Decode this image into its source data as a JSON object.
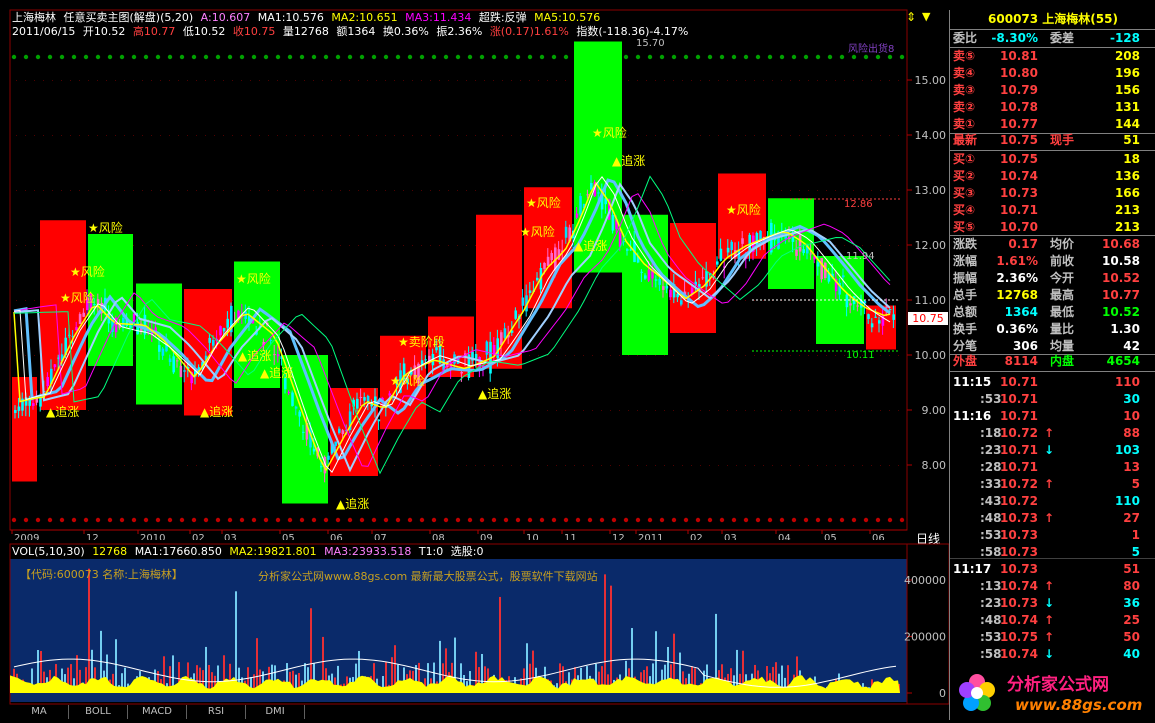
{
  "title_bar": {
    "stock_name": "上海梅林",
    "indicator": "任意买卖主图(解盘)(5,20)",
    "a_label": "A:10.607",
    "ma1": "MA1:10.576",
    "ma2": "MA2:10.651",
    "ma3": "MA3:11.434",
    "super": "超跌:反弹",
    "ma5": "MA5:10.576"
  },
  "info_line": {
    "date": "2011/06/15",
    "open": "开10.52",
    "high": "高10.77",
    "low": "低10.52",
    "close": "收10.75",
    "volume": "量12768",
    "amount": "额1364",
    "turnover": "换0.36%",
    "amplitude": "振2.36%",
    "change": "涨(0.17)1.61%",
    "index": "指数(-118.36)-4.17%"
  },
  "main_chart": {
    "y_ticks": [
      "15.00",
      "14.00",
      "13.00",
      "12.00",
      "11.00",
      "10.00",
      "9.00",
      "8.00"
    ],
    "x_ticks": [
      "2009",
      "12",
      "2010",
      "02",
      "03",
      "05",
      "06",
      "07",
      "08",
      "09",
      "10",
      "11",
      "12",
      "2011",
      "02",
      "03",
      "04",
      "05",
      "06"
    ],
    "period_button": "日线",
    "current_price_tag": "10.75",
    "annotations": {
      "high_label": "15.70",
      "level_1": "12.86",
      "level_2": "11.94",
      "level_3": "10.11",
      "risk": "★风险",
      "chase": "▲追涨",
      "first_sell": "★卖阶段",
      "top_right_ghost": "风险出货8"
    }
  },
  "vol_header": {
    "title": "VOL(5,10,30)",
    "value": "12768",
    "ma1": "MA1:17660.850",
    "ma2": "MA2:19821.801",
    "ma3": "MA3:23933.518",
    "t1": "T1:0",
    "select": "选股:0"
  },
  "vol_chart": {
    "y_ticks": [
      "400000",
      "200000",
      "0"
    ],
    "watermark_code": "【代码:600073 名称:上海梅林】",
    "watermark_site": "分析家公式网www.88gs.com 最新最大股票公式，股票软件下载网站"
  },
  "tabs": [
    "MA",
    "BOLL",
    "MACD",
    "RSI",
    "DMI"
  ],
  "quote_panel": {
    "title": "600073 上海梅林(55)",
    "weibi_label": "委比",
    "weibi_value": "-8.30%",
    "weicha_label": "委差",
    "weicha_value": "-128",
    "asks": [
      {
        "label": "卖⑤",
        "price": "10.81",
        "vol": "208"
      },
      {
        "label": "卖④",
        "price": "10.80",
        "vol": "196"
      },
      {
        "label": "卖③",
        "price": "10.79",
        "vol": "156"
      },
      {
        "label": "卖②",
        "price": "10.78",
        "vol": "131"
      },
      {
        "label": "卖①",
        "price": "10.77",
        "vol": "144"
      }
    ],
    "latest_label": "最新",
    "latest_value": "10.75",
    "xianshou_label": "现手",
    "xianshou_value": "51",
    "bids": [
      {
        "label": "买①",
        "price": "10.75",
        "vol": "18"
      },
      {
        "label": "买②",
        "price": "10.74",
        "vol": "136"
      },
      {
        "label": "买③",
        "price": "10.73",
        "vol": "166"
      },
      {
        "label": "买④",
        "price": "10.71",
        "vol": "213"
      },
      {
        "label": "买⑤",
        "price": "10.70",
        "vol": "213"
      }
    ],
    "stats": [
      {
        "l1": "涨跌",
        "v1": "0.17",
        "l2": "均价",
        "v2": "10.68"
      },
      {
        "l1": "涨幅",
        "v1": "1.61%",
        "l2": "前收",
        "v2": "10.58"
      },
      {
        "l1": "振幅",
        "v1": "2.36%",
        "l2": "今开",
        "v2": "10.52"
      },
      {
        "l1": "总手",
        "v1": "12768",
        "l2": "最高",
        "v2": "10.77"
      },
      {
        "l1": "总额",
        "v1": "1364",
        "l2": "最低",
        "v2": "10.52"
      },
      {
        "l1": "换手",
        "v1": "0.36%",
        "l2": "量比",
        "v2": "1.30"
      },
      {
        "l1": "分笔",
        "v1": "306",
        "l2": "均量",
        "v2": "42"
      }
    ],
    "outer_label": "外盘",
    "outer_value": "8114",
    "inner_label": "内盘",
    "inner_value": "4654",
    "ticks": [
      {
        "t": "11:15",
        "p": "10.71",
        "a": "",
        "v": "110"
      },
      {
        "t": ":53",
        "p": "10.71",
        "a": "",
        "v": "30"
      },
      {
        "t": "11:16",
        "p": "10.71",
        "a": "",
        "v": "10"
      },
      {
        "t": ":18",
        "p": "10.72",
        "a": "↑",
        "v": "88"
      },
      {
        "t": ":23",
        "p": "10.71",
        "a": "↓",
        "v": "103"
      },
      {
        "t": ":28",
        "p": "10.71",
        "a": "",
        "v": "13"
      },
      {
        "t": ":33",
        "p": "10.72",
        "a": "↑",
        "v": "5"
      },
      {
        "t": ":43",
        "p": "10.72",
        "a": "",
        "v": "110"
      },
      {
        "t": ":48",
        "p": "10.73",
        "a": "↑",
        "v": "27"
      },
      {
        "t": ":53",
        "p": "10.73",
        "a": "",
        "v": "1"
      },
      {
        "t": ":58",
        "p": "10.73",
        "a": "",
        "v": "5"
      },
      {
        "t": "11:17",
        "p": "10.73",
        "a": "",
        "v": "51"
      },
      {
        "t": ":13",
        "p": "10.74",
        "a": "↑",
        "v": "80"
      },
      {
        "t": ":23",
        "p": "10.73",
        "a": "↓",
        "v": "36"
      },
      {
        "t": ":48",
        "p": "10.74",
        "a": "↑",
        "v": "25"
      },
      {
        "t": ":53",
        "p": "10.75",
        "a": "↑",
        "v": "50"
      },
      {
        "t": ":58",
        "p": "10.74",
        "a": "↓",
        "v": "40"
      }
    ]
  },
  "logo": {
    "name": "分析家公式网",
    "url": "www.88gs.com"
  },
  "colors": {
    "up": "#ff0000",
    "down": "#00ff00",
    "cyan": "#00ffff",
    "yellow": "#ffff00",
    "volbg": "#0a2a6a"
  }
}
